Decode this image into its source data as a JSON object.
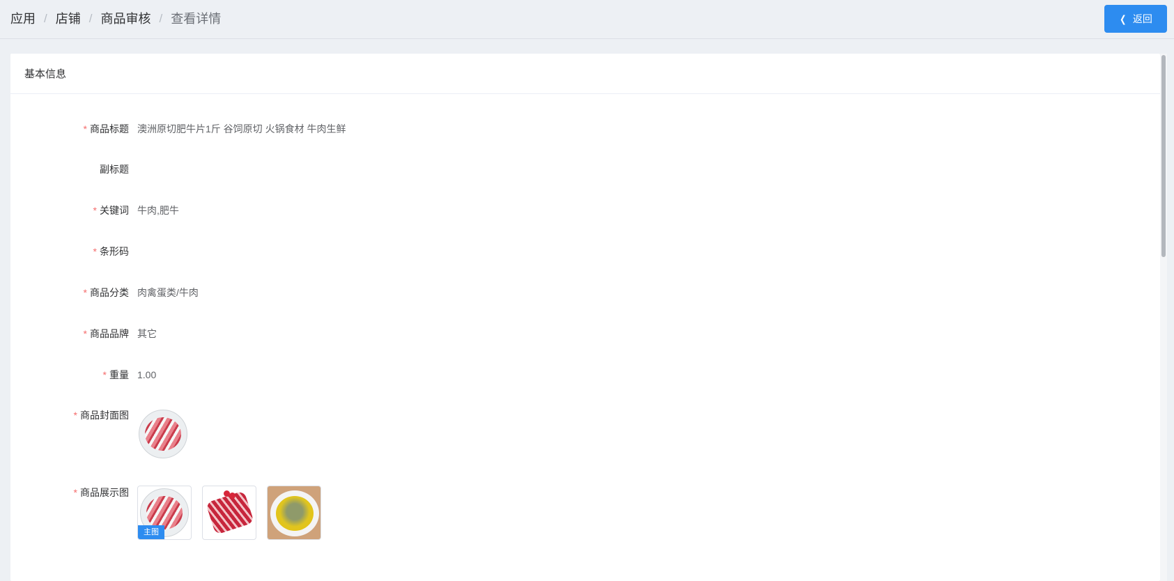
{
  "breadcrumb": [
    "应用",
    "店铺",
    "商品审核",
    "查看详情"
  ],
  "header": {
    "back_label": "返回"
  },
  "card": {
    "title": "基本信息"
  },
  "fields": [
    {
      "label": "商品标题",
      "required": true,
      "value": "澳洲原切肥牛片1斤 谷饲原切 火锅食材 牛肉生鲜"
    },
    {
      "label": "副标题",
      "required": false,
      "value": ""
    },
    {
      "label": "关键词",
      "required": true,
      "value": "牛肉,肥牛"
    },
    {
      "label": "条形码",
      "required": true,
      "value": ""
    },
    {
      "label": "商品分类",
      "required": true,
      "value": "肉禽蛋类/牛肉"
    },
    {
      "label": "商品品牌",
      "required": true,
      "value": "其它"
    },
    {
      "label": "重量",
      "required": true,
      "value": "1.00"
    }
  ],
  "cover": {
    "label": "商品封面图",
    "required": true
  },
  "gallery": {
    "label": "商品展示图",
    "required": true,
    "main_tag": "主图"
  },
  "colors": {
    "accent": "#2d8cf0",
    "required": "#f56c6c"
  }
}
